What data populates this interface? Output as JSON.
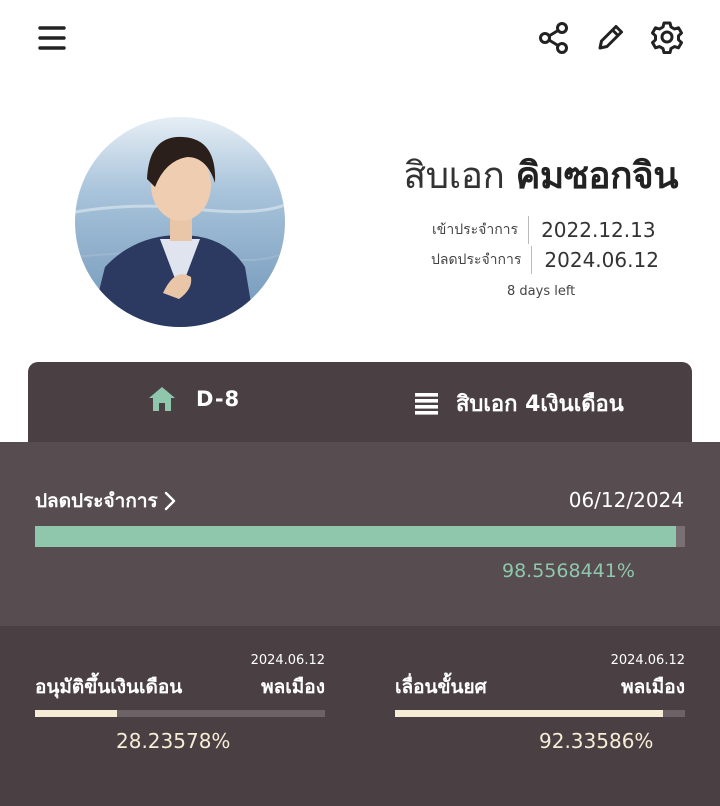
{
  "header": {
    "menu_icon": "hamburger-menu-icon",
    "share_icon": "share-icon",
    "edit_icon": "pencil-icon",
    "settings_icon": "gear-icon"
  },
  "profile": {
    "rank": "สิบเอก",
    "name": "คิมซอกจิน",
    "enlist_label": "เข้าประจำการ",
    "enlist_date": "2022.12.13",
    "discharge_label": "ปลดประจำการ",
    "discharge_date": "2024.06.12",
    "days_left": "8 days left"
  },
  "summary_tab": {
    "dday": "D-8",
    "rank_status": "สิบเอก 4เงินเดือน",
    "home_icon": "home-icon",
    "list_icon": "list-icon"
  },
  "discharge_progress": {
    "title": "ปลดประจำการ",
    "date": "06/12/2024",
    "percent_text": "98.5568441%",
    "fraction": 0.985568441
  },
  "salary_progress": {
    "date": "2024.06.12",
    "title": "อนุมัติขึ้นเงินเดือน",
    "target": "พลเมือง",
    "percent_text": "28.23578%",
    "fraction": 0.2823578
  },
  "promotion_progress": {
    "date": "2024.06.12",
    "title": "เลื่อนขั้นยศ",
    "target": "พลเมือง",
    "percent_text": "92.33586%",
    "fraction": 0.9233586
  },
  "colors": {
    "accent_green": "#8fc7ad",
    "cream": "#f7ecd6",
    "dark_panel": "#4a3f42",
    "mid_panel": "#574c50"
  }
}
